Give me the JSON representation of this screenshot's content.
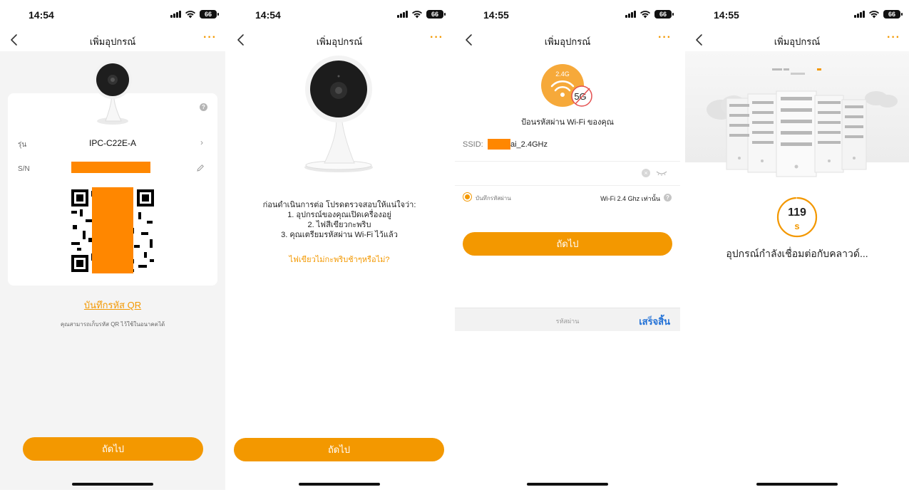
{
  "common": {
    "nav_title": "เพิ่มอุปกรณ์",
    "more_label": "···",
    "battery": "66",
    "next_label": "ถัดไป"
  },
  "screens": [
    {
      "time": "14:54",
      "model_label": "รุ่น",
      "model_value": "IPC-C22E-A",
      "sn_label": "S/N",
      "save_qr": "บันทึกรหัส QR",
      "save_qr_note": "คุณสามารถเก็บรหัส QR ไว้ใช้ในอนาคตได้"
    },
    {
      "time": "14:54",
      "instr_title": "ก่อนดำเนินการต่อ โปรดตรวจสอบให้แน่ใจว่า:",
      "instr_1": "1. อุปกรณ์ของคุณเปิดเครื่องอยู่",
      "instr_2": "2. ไฟสีเขียวกะพริบ",
      "instr_3": "3. คุณเตรียมรหัสผ่าน Wi-Fi ไว้แล้ว",
      "link": "ไฟเขียวไม่กะพริบช้าๆหรือไม่?"
    },
    {
      "time": "14:55",
      "badge_24": "2.4G",
      "badge_5": "5G",
      "enter_wifi": "ป้อนรหัสผ่าน Wi-Fi ของคุณ",
      "ssid_label": "SSID:",
      "ssid_value": "ai_2.4GHz",
      "save_password": "บันทึกรหัสผ่าน",
      "wifi_only": "Wi-Fi 2.4 Ghz เท่านั้น",
      "kb_title": "รหัสผ่าน",
      "kb_done": "เสร็จสิ้น"
    },
    {
      "time": "14:55",
      "countdown": "119",
      "countdown_unit": "s",
      "connecting": "อุปกรณ์กำลังเชื่อมต่อกับคลาวด์..."
    }
  ],
  "colors": {
    "accent": "#f39800",
    "redaction": "#ff8700",
    "link_blue": "#1f6fd6"
  },
  "countdown_progress": 0.99
}
